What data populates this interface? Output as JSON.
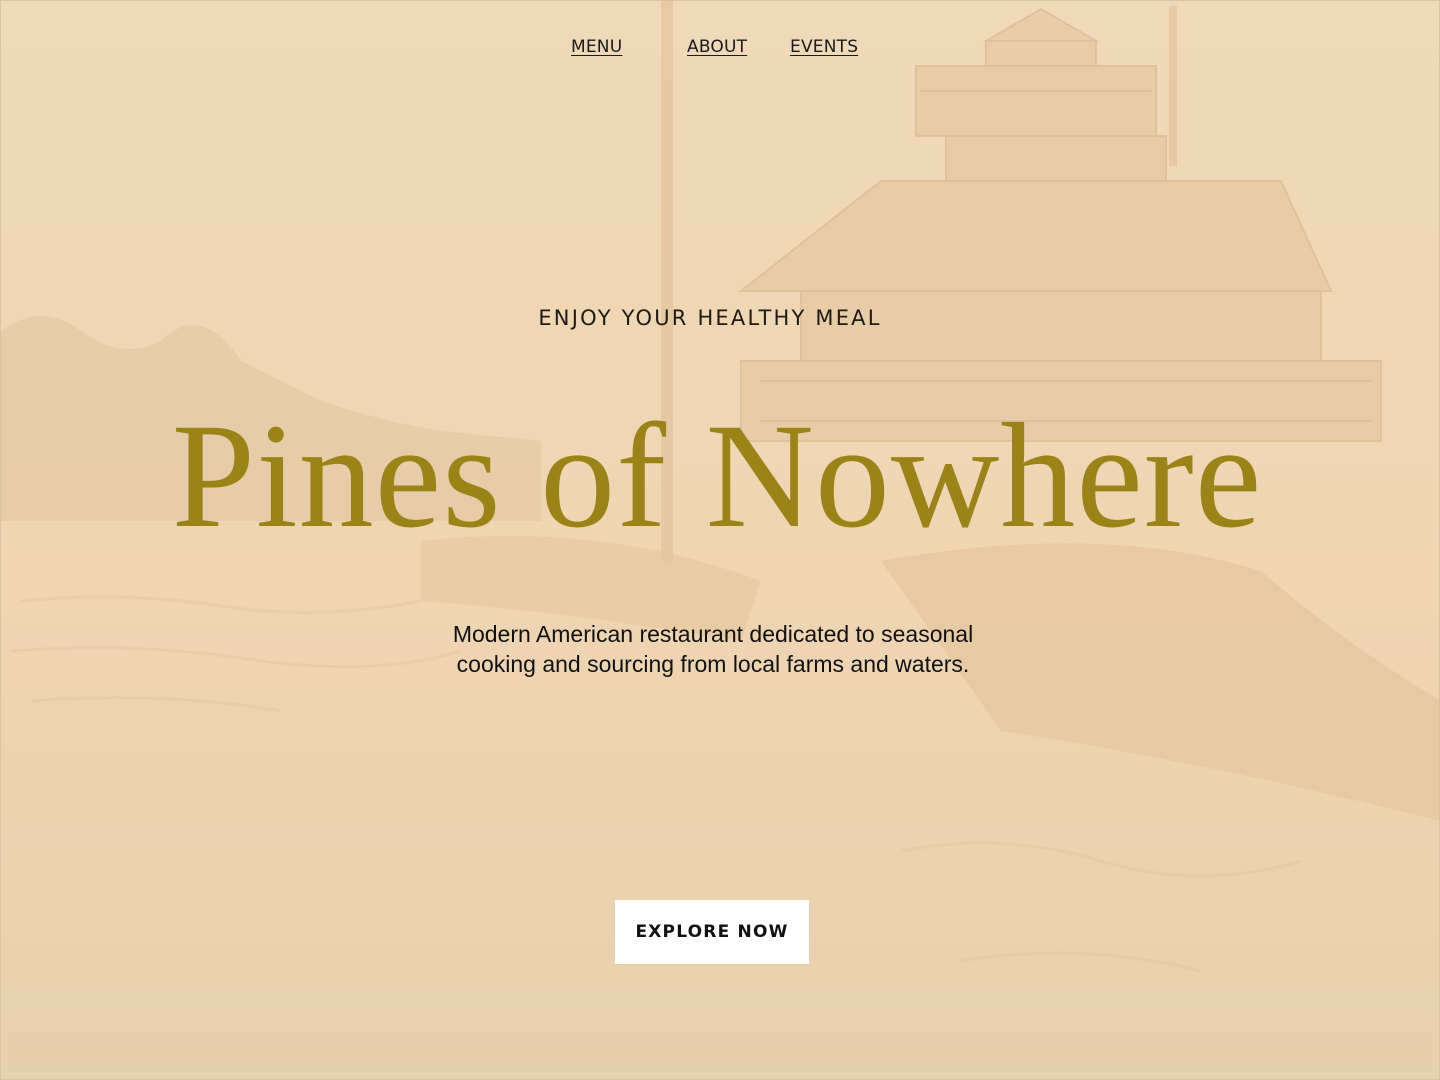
{
  "nav": {
    "items": [
      {
        "label": "MENU"
      },
      {
        "label": "ABOUT"
      },
      {
        "label": "EVENTS"
      }
    ]
  },
  "hero": {
    "tagline": "ENJOY YOUR HEALTHY MEAL",
    "title": "Pines of Nowhere",
    "description_line1": "Modern American restaurant dedicated to seasonal",
    "description_line2": "cooking and sourcing from local farms and waters.",
    "cta_label": "EXPLORE NOW"
  },
  "colors": {
    "background": "#ecd6b6",
    "title": "#9a8418",
    "text": "#111111",
    "button_bg": "#ffffff"
  }
}
